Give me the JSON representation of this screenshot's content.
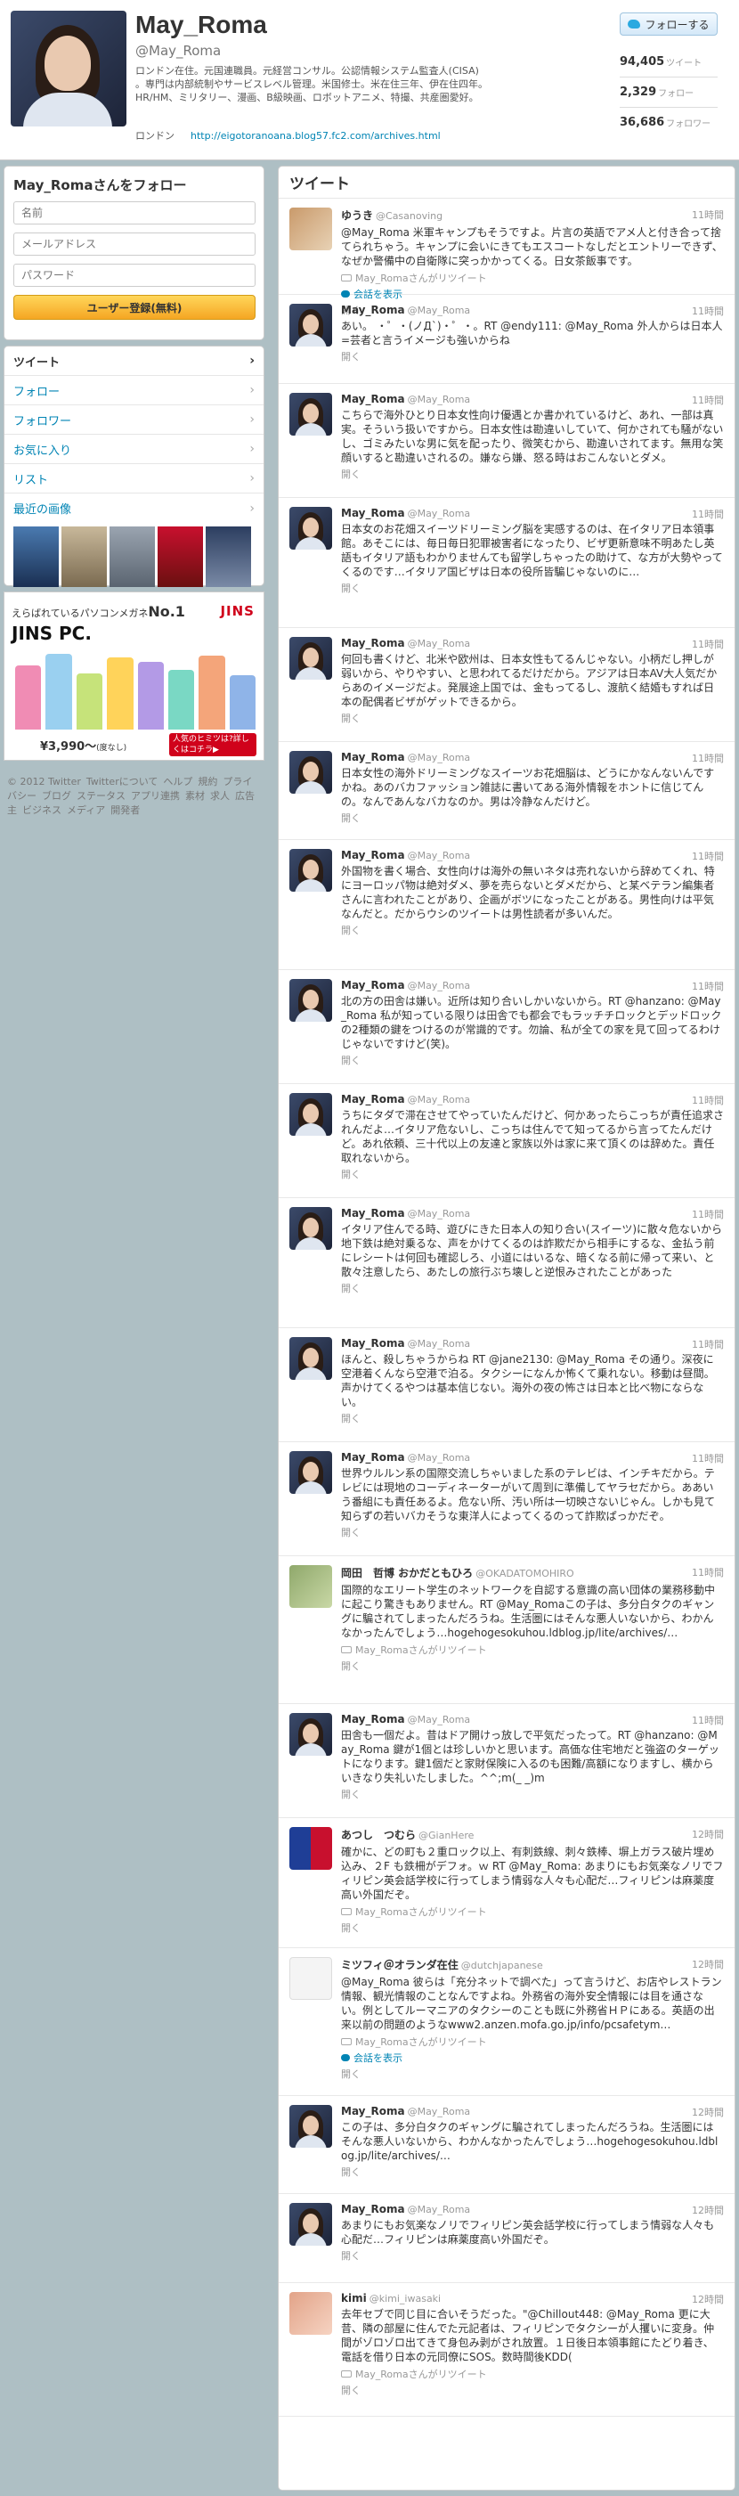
{
  "profile": {
    "name": "May_Roma",
    "handle": "@May_Roma",
    "bio": "ロンドン在住。元国連職員。元経営コンサル。公認情報システム監査人(CISA) 。専門は内部統制やサービスレベル管理。米国修士。米在住三年、伊在住四年。HR/HM、ミリタリー、漫画、B級映画、ロボットアニメ、特撮、共産圏愛好。",
    "location": "ロンドン",
    "url": "http://eigotoranoana.blog57.fc2.com/archives.html",
    "follow_button": "フォローする",
    "stats": [
      {
        "value": "94,405",
        "label": "ツイート"
      },
      {
        "value": "2,329",
        "label": "フォロー"
      },
      {
        "value": "36,686",
        "label": "フォロワー"
      }
    ]
  },
  "follow_panel": {
    "title": "May_Romaさんをフォロー",
    "name_placeholder": "名前",
    "email_placeholder": "メールアドレス",
    "password_placeholder": "パスワード",
    "signup_label": "ユーザー登録(無料)"
  },
  "nav": [
    {
      "label": "ツイート"
    },
    {
      "label": "フォロー"
    },
    {
      "label": "フォロワー"
    },
    {
      "label": "お気に入り"
    },
    {
      "label": "リスト"
    },
    {
      "label": "最近の画像"
    }
  ],
  "ad": {
    "line1": "えらばれているパソコンメガネ",
    "line1_rank": "No.1",
    "brand": "JINS",
    "line2": "JINS PC.",
    "price": "¥3,990～",
    "price_note": "(度なし)",
    "cta": "人気のヒミツは?詳しくはコチラ▶"
  },
  "footer": {
    "links": [
      "© 2012 Twitter",
      "Twitterについて",
      "ヘルプ",
      "規約",
      "プライバシー",
      "ブログ",
      "ステータス",
      "アプリ連携",
      "素材",
      "求人",
      "広告主",
      "ビジネス",
      "メディア",
      "開発者"
    ]
  },
  "timeline": {
    "title": "ツイート",
    "retweet_suffix": "May_Romaさんがリツイート",
    "conversation_label": "会話を表示",
    "open_label": "開く",
    "tweets": [
      {
        "name": "ゆうき",
        "handle": "@Casanoving",
        "time": "11時間",
        "text": "@May_Roma 米軍キャンプもそうですよ。片言の英語でアメ人と付き合って捨てられちゃう。キャンプに会いにきてもエスコートなしだとエントリーできず、なぜか警備中の自衛隊に突っかかってくる。日女茶飯事です。",
        "retweet": true,
        "conversation": true
      },
      {
        "name": "May_Roma",
        "handle": "@May_Roma",
        "time": "11時間",
        "text": "あい。 ・゜・(ノД`)・゜・。RT @endy111: @May_Roma 外人からは日本人=芸者と言うイメージも強いからね",
        "retweet": false,
        "conversation": false
      },
      {
        "name": "May_Roma",
        "handle": "@May_Roma",
        "time": "11時間",
        "text": "こちらで海外ひとり日本女性向け優遇とか書かれているけど、あれ、一部は真実。そういう扱いですから。日本女性は勘違いしていて、何かされても騒がないし、ゴミみたいな男に気を配ったり、微笑むから、勘違いされてます。無用な笑顔いすると勘違いされるの。嫌なら嫌、怒る時はおこんないとダメ。",
        "retweet": false,
        "conversation": false
      },
      {
        "name": "May_Roma",
        "handle": "@May_Roma",
        "time": "11時間",
        "text": "日本女のお花畑スイーツドリーミング脳を実感するのは、在イタリア日本領事館。あそこには、毎日毎日犯罪被害者になったり、ビザ更新意味不明あたし英語もイタリア語もわかりませんても留学しちゃったの助けて、な方が大勢やってくるのです…イタリア国ビザは日本の役所皆騙じゃないのに…",
        "retweet": false,
        "conversation": false
      },
      {
        "name": "May_Roma",
        "handle": "@May_Roma",
        "time": "11時間",
        "text": "何回も書くけど、北米や欧州は、日本女性もてるんじゃない。小柄だし押しが弱いから、やりやすい、と思われてるだけだから。アジアは日本AV大人気だからあのイメージだよ。発展途上国では、金もってるし、渡航く結婚もすれば日本の配偶者ビザがゲットできるから。",
        "retweet": false,
        "conversation": false
      },
      {
        "name": "May_Roma",
        "handle": "@May_Roma",
        "time": "11時間",
        "text": "日本女性の海外ドリーミングなスイーツお花畑脳は、どうにかなんないんですかね。あのバカファッション雑誌に書いてある海外情報をホントに信じてんの。なんであんなバカなのか。男は冷静なんだけど。",
        "retweet": false,
        "conversation": false
      },
      {
        "name": "May_Roma",
        "handle": "@May_Roma",
        "time": "11時間",
        "text": "外国物を書く場合、女性向けは海外の無いネタは売れないから辞めてくれ、特にヨーロッパ物は絶対ダメ、夢を売らないとダメだから、と某ベテラン編集者さんに言われたことがあり、企画がボツになったことがある。男性向けは平気なんだと。だからウシのツイートは男性読者が多いんだ。",
        "retweet": false,
        "conversation": false
      },
      {
        "name": "May_Roma",
        "handle": "@May_Roma",
        "time": "11時間",
        "text": "北の方の田舎は嫌い。近所は知り合いしかいないから。RT @hanzano: @May_Roma 私が知っている限りは田舎でも都会でもラッチチロックとデッドロックの2種類の鍵をつけるのが常識的です。勿論、私が全ての家を見て回ってるわけじゃないですけど(笑)。",
        "retweet": false,
        "conversation": false
      },
      {
        "name": "May_Roma",
        "handle": "@May_Roma",
        "time": "11時間",
        "text": "うちにタダで滞在させてやっていたんだけど、何かあったらこっちが責任追求されんだよ…イタリア危ないし、こっちは住んでて知ってるから言ってたんだけど。あれ依頼、三十代以上の友達と家族以外は家に来て頂くのは辞めた。責任取れないから。",
        "retweet": false,
        "conversation": false
      },
      {
        "name": "May_Roma",
        "handle": "@May_Roma",
        "time": "11時間",
        "text": "イタリア住んでる時、遊びにきた日本人の知り合い(スイーツ)に散々危ないから地下鉄は絶対乗るな、声をかけてくるのは詐欺だから相手にするな、金払う前にレシートは何回も確認しろ、小道にはいるな、暗くなる前に帰って来い、と散々注意したら、あたしの旅行ぶち壊しと逆恨みされたことがあった",
        "retweet": false,
        "conversation": false
      },
      {
        "name": "May_Roma",
        "handle": "@May_Roma",
        "time": "11時間",
        "text": "ほんと、殺しちゃうからね RT @jane2130: @May_Roma その通り。深夜に空港着くんなら空港で泊る。タクシーになんか怖くて乗れない。移動は昼間。声かけてくるやつは基本信じない。海外の夜の怖さは日本と比べ物にならない。",
        "retweet": false,
        "conversation": false
      },
      {
        "name": "May_Roma",
        "handle": "@May_Roma",
        "time": "11時間",
        "text": "世界ウルルン系の国際交流しちゃいました系のテレビは、インチキだから。テレビには現地のコーディネーターがいて周到に準備してヤラセだから。ああいう番組にも責任あるよ。危ない所、汚い所は一切映さないじゃん。しかも見て知らずの若いバカそうな東洋人によってくるのって詐欺ぱっかだぞ。",
        "retweet": false,
        "conversation": false
      },
      {
        "name": "岡田　哲博 おかだともひろ",
        "handle": "@OKADATOMOHIRO",
        "time": "11時間",
        "text": "国際的なエリート学生のネットワークを自認する意識の高い団体の業務移動中に起こり驚きもありません。RT @May_Romaこの子は、多分白タクのギャングに騙されてしまったんだろうね。生活圏にはそんな悪人いないから、わかんなかったんでしょう…hogehogesokuhou.ldblog.jp/lite/archives/…",
        "retweet": true,
        "conversation": false
      },
      {
        "name": "May_Roma",
        "handle": "@May_Roma",
        "time": "11時間",
        "text": "田舎も一個だよ。昔はドア開けっ放しで平気だったって。RT @hanzano: @May_Roma 鍵が1個とは珍しいかと思います。高価な住宅地だと強盗のターゲットになります。鍵1個だと家財保険に入るのも困難/高額になりますし、横からいきなり失礼いたしました。^^;m(_ _)m",
        "retweet": false,
        "conversation": false
      },
      {
        "name": "あつし　つむら",
        "handle": "@GianHere",
        "time": "12時間",
        "text": "確かに、どの町も２重ロック以上、有刺鉄線、刺々鉄棒、塀上ガラス破片埋め込み、２F も鉄柵がデフォ。ｗ RT @May_Roma: あまりにもお気楽なノリでフィリピン英会話学校に行ってしまう情弱な人々も心配だ…フィリピンは麻薬度高い外国だぞ。",
        "retweet": true,
        "conversation": false
      },
      {
        "name": "ミツフィ＠オランダ在住",
        "handle": "@dutchjapanese",
        "time": "12時間",
        "text": "@May_Roma 彼らは「充分ネットで調べた」って言うけど、お店やレストラン情報、観光情報のことなんですよね。外務省の海外安全情報には目を通さない。例としてルーマニアのタクシーのことも既に外務省ＨＰにある。英語の出来以前の問題のようなwww2.anzen.mofa.go.jp/info/pcsafetym…",
        "retweet": true,
        "conversation": true
      },
      {
        "name": "May_Roma",
        "handle": "@May_Roma",
        "time": "12時間",
        "text": "この子は、多分白タクのギャングに騙されてしまったんだろうね。生活圏にはそんな悪人いないから、わかんなかったんでしょう…hogehogesokuhou.ldblog.jp/lite/archives/…",
        "retweet": false,
        "conversation": false
      },
      {
        "name": "May_Roma",
        "handle": "@May_Roma",
        "time": "12時間",
        "text": "あまりにもお気楽なノリでフィリピン英会話学校に行ってしまう情弱な人々も心配だ…フィリピンは麻薬度高い外国だぞ。",
        "retweet": false,
        "conversation": false
      },
      {
        "name": "kimi",
        "handle": "@kimi_iwasaki",
        "time": "12時間",
        "text": "去年セブで同じ目に合いそうだった。\"@Chillout448: @May_Roma 更に大昔、隣の部屋に住んでた元記者は、フィリピンでタクシーが人攫いに変身。仲間がゾロゾロ出てきて身包み剥がされ放置。１日後日本領事館にたどり着き、電話を借り日本の元同僚にSOS。数時間後KDD(",
        "retweet": true,
        "conversation": false
      }
    ]
  }
}
